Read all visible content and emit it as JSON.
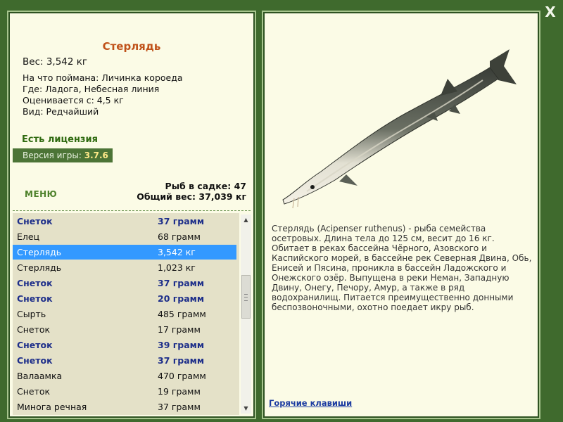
{
  "close_label": "X",
  "fish": {
    "name": "Стерлядь",
    "weight": "Вес: 3,542 кг",
    "details": [
      "На что поймана: Личинка короеда",
      "Где: Ладога, Небесная линия",
      "Оценивается с: 4,5 кг",
      "Вид: Редчайший"
    ],
    "license": "Есть лицензия"
  },
  "version": {
    "label": "Версия игры:",
    "value": "3.7.6"
  },
  "menu_label": "МЕНЮ",
  "cage": {
    "count_text": "Рыб в садке: 47",
    "total_text": "Общий вес: 37,039 кг"
  },
  "fish_list": [
    {
      "name": "Снеток",
      "weight": "37 грамм",
      "bold": true
    },
    {
      "name": "Елец",
      "weight": "68 грамм",
      "bold": false
    },
    {
      "name": "Стерлядь",
      "weight": "3,542 кг",
      "bold": false,
      "selected": true
    },
    {
      "name": "Стерлядь",
      "weight": "1,023 кг",
      "bold": false
    },
    {
      "name": "Снеток",
      "weight": "37 грамм",
      "bold": true
    },
    {
      "name": "Снеток",
      "weight": "20 грамм",
      "bold": true
    },
    {
      "name": "Сырть",
      "weight": "485 грамм",
      "bold": false
    },
    {
      "name": "Снеток",
      "weight": "17 грамм",
      "bold": false
    },
    {
      "name": "Снеток",
      "weight": "39 грамм",
      "bold": true
    },
    {
      "name": "Снеток",
      "weight": "37 грамм",
      "bold": true
    },
    {
      "name": "Валаамка",
      "weight": "470 грамм",
      "bold": false
    },
    {
      "name": "Снеток",
      "weight": "19 грамм",
      "bold": false
    },
    {
      "name": "Минога речная",
      "weight": "37 грамм",
      "bold": false
    }
  ],
  "description": "Стерлядь (Acipenser ruthenus) - рыба семейства осетровых. Длина тела до 125 см, весит до 16 кг. Обитает в реках бассейна Чёрного, Азовского и Каспийского морей, в бассейне рек Северная Двина, Обь, Енисей и Пясина, проникла в бассейн Ладожского и Онежского озёр. Выпущена в реки Неман, Западную Двину, Онегу, Печору, Амур, а также в ряд водохранилищ. Питается преимущественно донными беспозвоночными, охотно поедает икру рыб.",
  "hotkeys_label": "Горячие клавиши",
  "colors": {
    "background": "#3f6a2d",
    "panel": "#fbfbe6",
    "list_bg": "#e4e1c8",
    "title": "#c0521a",
    "license": "#2f6a10",
    "bold_row": "#1e2f8a",
    "selected_row": "#3399ff",
    "link": "#1a3aa0"
  }
}
